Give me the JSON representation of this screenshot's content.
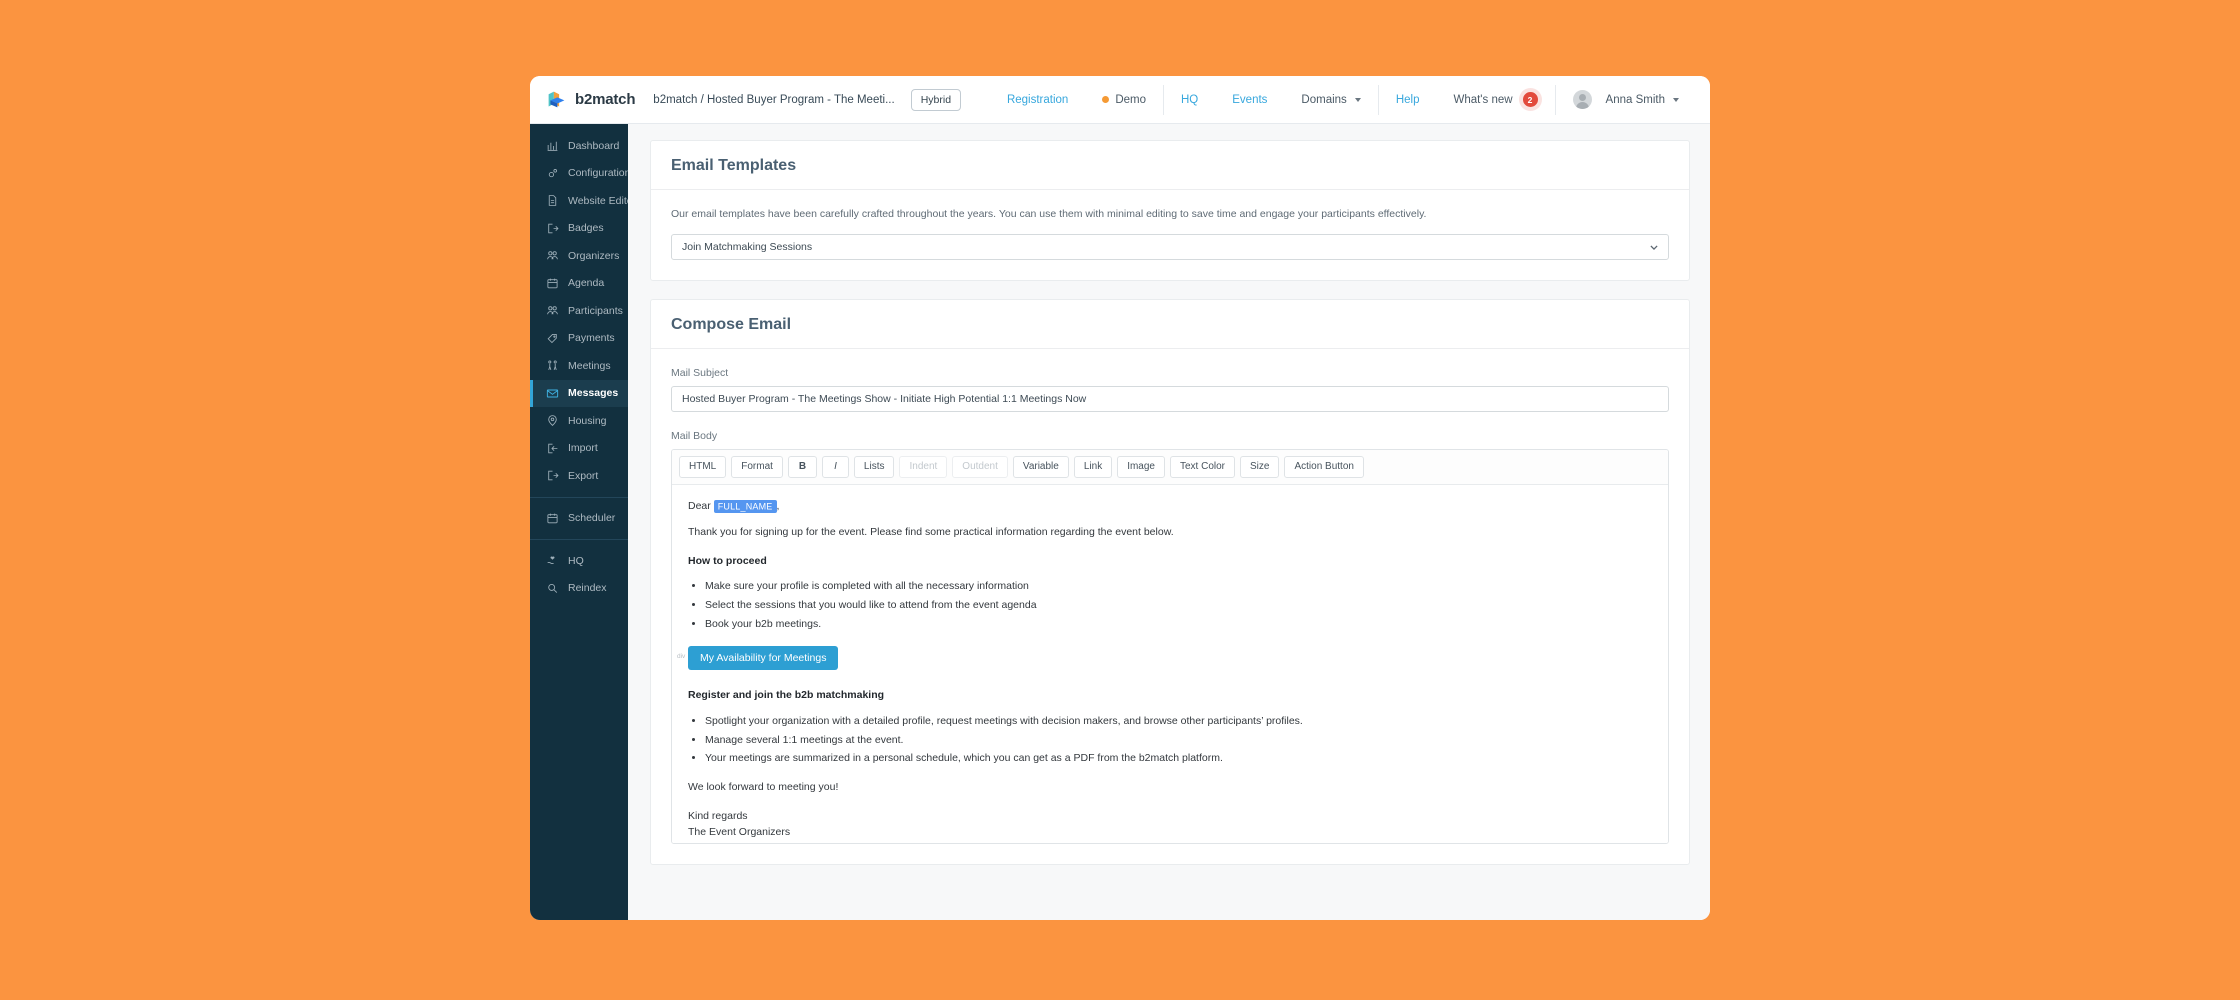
{
  "header": {
    "brand_name": "b2match",
    "brand_logo_icon": "b2match-cube-logo",
    "breadcrumb": "b2match / Hosted Buyer Program - The Meeti...",
    "event_type_badge": "Hybrid",
    "nav": [
      {
        "label": "Registration",
        "style": "link"
      },
      {
        "label": "Demo",
        "style": "muted",
        "icon": "orange-status-dot"
      },
      {
        "label": "HQ",
        "style": "link"
      },
      {
        "label": "Events",
        "style": "link"
      },
      {
        "label": "Domains",
        "style": "muted",
        "icon": "chevron-down-icon"
      },
      {
        "label": "Help",
        "style": "link"
      },
      {
        "label": "What's new",
        "style": "muted",
        "badge": "2"
      }
    ],
    "user_name": "Anna Smith"
  },
  "sidebar": {
    "items": [
      {
        "label": "Dashboard",
        "icon": "bar-chart-icon",
        "active": false
      },
      {
        "label": "Configuration",
        "icon": "gears-icon",
        "active": false
      },
      {
        "label": "Website Editor",
        "icon": "document-icon",
        "active": false
      },
      {
        "label": "Badges",
        "icon": "badge-exit-icon",
        "active": false
      },
      {
        "label": "Organizers",
        "icon": "people-icon",
        "active": false
      },
      {
        "label": "Agenda",
        "icon": "calendar-icon",
        "active": false
      },
      {
        "label": "Participants",
        "icon": "people-icon",
        "active": false
      },
      {
        "label": "Payments",
        "icon": "tag-icon",
        "active": false
      },
      {
        "label": "Meetings",
        "icon": "handshake-icon",
        "active": false
      },
      {
        "label": "Messages",
        "icon": "envelope-icon",
        "active": true
      },
      {
        "label": "Housing",
        "icon": "location-pin-icon",
        "active": false
      },
      {
        "label": "Import",
        "icon": "import-icon",
        "active": false
      },
      {
        "label": "Export",
        "icon": "export-icon",
        "active": false
      },
      {
        "divider": true
      },
      {
        "label": "Scheduler",
        "icon": "calendar-icon",
        "active": false
      },
      {
        "divider": true
      },
      {
        "label": "HQ",
        "icon": "hand-heart-icon",
        "active": false
      },
      {
        "label": "Reindex",
        "icon": "magnifier-icon",
        "active": false
      }
    ]
  },
  "templates_card": {
    "title": "Email Templates",
    "description": "Our email templates have been carefully crafted throughout the years. You can use them with minimal editing to save time and engage your participants effectively.",
    "selected_template": "Join Matchmaking Sessions"
  },
  "compose_card": {
    "title": "Compose Email",
    "subject_label": "Mail Subject",
    "subject_value": "Hosted Buyer Program - The Meetings Show - Initiate High Potential 1:1 Meetings Now",
    "body_label": "Mail Body",
    "toolbar": [
      {
        "label": "HTML",
        "disabled": false
      },
      {
        "label": "Format",
        "disabled": false
      },
      {
        "label": "B",
        "disabled": false,
        "style": "bold"
      },
      {
        "label": "I",
        "disabled": false,
        "style": "italic"
      },
      {
        "label": "Lists",
        "disabled": false
      },
      {
        "label": "Indent",
        "disabled": true
      },
      {
        "label": "Outdent",
        "disabled": true
      },
      {
        "label": "Variable",
        "disabled": false
      },
      {
        "label": "Link",
        "disabled": false
      },
      {
        "label": "Image",
        "disabled": false
      },
      {
        "label": "Text Color",
        "disabled": false
      },
      {
        "label": "Size",
        "disabled": false
      },
      {
        "label": "Action Button",
        "disabled": false
      }
    ],
    "body": {
      "greeting_prefix": "Dear",
      "greeting_variable": "FULL_NAME",
      "greeting_suffix": ",",
      "intro": "Thank you for signing up for the event. Please find some practical information regarding the event below.",
      "section1_heading": "How to proceed",
      "section1_items": [
        "Make sure your profile is completed with all the necessary information",
        "Select the sessions that you would like to attend from the event agenda",
        "Book your b2b meetings."
      ],
      "block_tag": "div",
      "action_button_label": "My Availability for Meetings",
      "section2_heading": "Register and join the b2b matchmaking",
      "section2_items": [
        "Spotlight your organization with a detailed profile, request meetings with decision makers, and browse other participants’ profiles.",
        "Manage several 1:1 meetings at the event.",
        "Your meetings are summarized in a personal schedule, which you can get as a PDF from the b2match platform."
      ],
      "closing": "We look forward to meeting you!",
      "signoff_line1": "Kind regards",
      "signoff_line2": "The Event Organizers"
    }
  },
  "colors": {
    "page_background": "#FB9440",
    "sidebar": "#12303F",
    "sidebar_active": "#1B3D4E",
    "accent": "#33A5D8",
    "link": "#37A7DD",
    "action_button": "#2D9FD3",
    "variable_chip": "#5596F0",
    "badge": "#E24A3C",
    "status_dot": "#F59A34"
  }
}
